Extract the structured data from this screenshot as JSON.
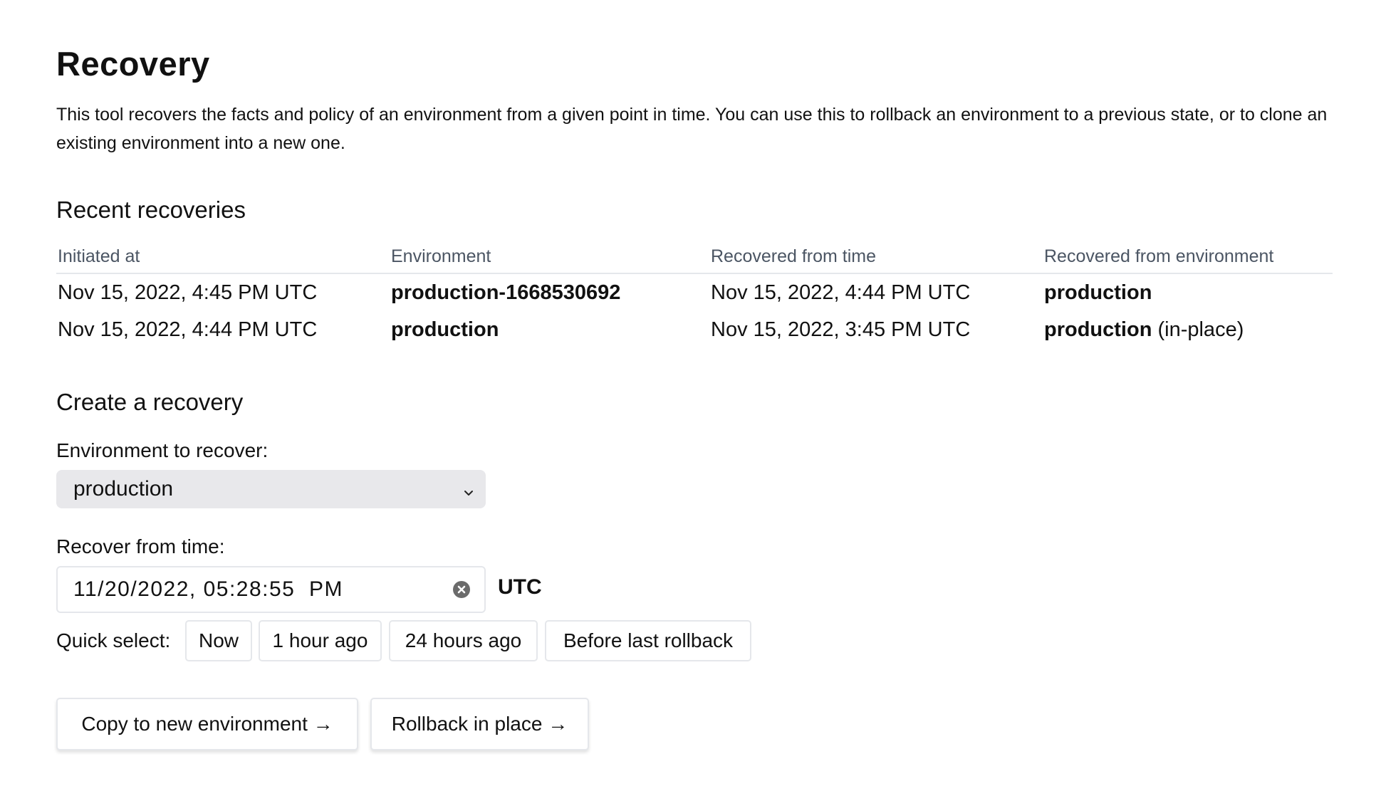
{
  "page": {
    "title": "Recovery",
    "intro": "This tool recovers the facts and policy of an environment from a given point in time. You can use this to rollback an environment to a previous state, or to clone an existing environment into a new one."
  },
  "recent": {
    "title": "Recent recoveries",
    "columns": [
      "Initiated at",
      "Environment",
      "Recovered from time",
      "Recovered from environment"
    ],
    "rows": [
      {
        "initiated_at": "Nov 15, 2022, 4:45 PM UTC",
        "environment": "production-1668530692",
        "recovered_from_time": "Nov 15, 2022, 4:44 PM UTC",
        "recovered_from_env": "production",
        "note": ""
      },
      {
        "initiated_at": "Nov 15, 2022, 4:44 PM UTC",
        "environment": "production",
        "recovered_from_time": "Nov 15, 2022, 3:45 PM UTC",
        "recovered_from_env": "production",
        "note": " (in-place)"
      }
    ]
  },
  "create": {
    "title": "Create a recovery",
    "env_label": "Environment to recover:",
    "env_selected": "production",
    "time_label": "Recover from time:",
    "time_value": "11/20/2022, 05:28:55  PM",
    "timezone": "UTC",
    "quick_label": "Quick select:",
    "quick_options": [
      "Now",
      "1 hour ago",
      "24 hours ago",
      "Before last rollback"
    ],
    "copy_button": "Copy to new environment →",
    "rollback_button": "Rollback in place →"
  },
  "icons": {
    "select_chevron": "chevron-down-icon",
    "clear": "clear-circle-x-icon"
  },
  "colors": {
    "header_text": "#4b5563",
    "border": "#e5e7eb",
    "select_bg": "#e8e8eb"
  }
}
